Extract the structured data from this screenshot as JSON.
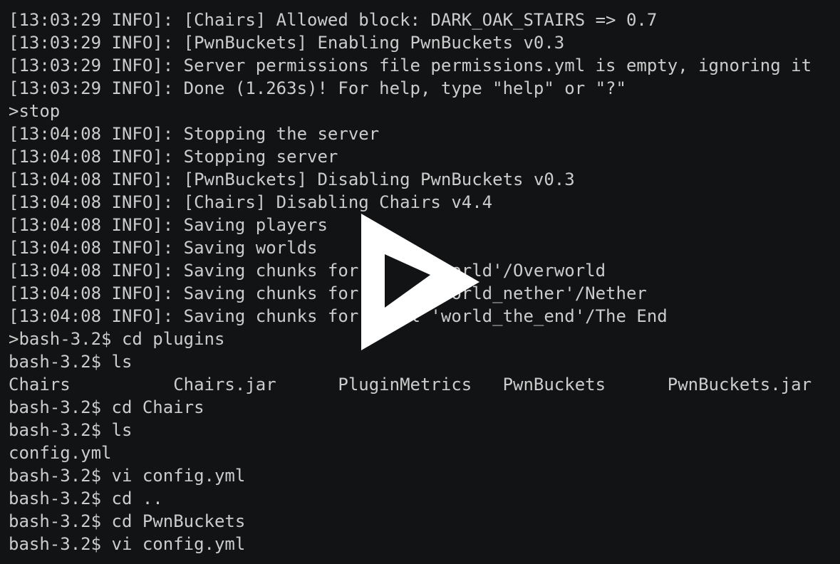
{
  "terminal": {
    "lines": [
      "[13:03:29 INFO]: [Chairs] Allowed block: DARK_OAK_STAIRS => 0.7",
      "[13:03:29 INFO]: [PwnBuckets] Enabling PwnBuckets v0.3",
      "[13:03:29 INFO]: Server permissions file permissions.yml is empty, ignoring it",
      "[13:03:29 INFO]: Done (1.263s)! For help, type \"help\" or \"?\"",
      ">stop",
      "[13:04:08 INFO]: Stopping the server",
      "[13:04:08 INFO]: Stopping server",
      "[13:04:08 INFO]: [PwnBuckets] Disabling PwnBuckets v0.3",
      "[13:04:08 INFO]: [Chairs] Disabling Chairs v4.4",
      "[13:04:08 INFO]: Saving players",
      "[13:04:08 INFO]: Saving worlds",
      "[13:04:08 INFO]: Saving chunks for level 'world'/Overworld",
      "[13:04:08 INFO]: Saving chunks for level 'world_nether'/Nether",
      "[13:04:08 INFO]: Saving chunks for level 'world_the_end'/The End",
      ">bash-3.2$ cd plugins",
      "bash-3.2$ ls",
      "Chairs          Chairs.jar      PluginMetrics   PwnBuckets      PwnBuckets.jar",
      "bash-3.2$ cd Chairs",
      "bash-3.2$ ls",
      "config.yml",
      "bash-3.2$ vi config.yml",
      "bash-3.2$ cd ..",
      "bash-3.2$ cd PwnBuckets",
      "bash-3.2$ vi config.yml"
    ]
  },
  "overlay": {
    "icon": "asciinema-play-icon",
    "color": "#ffffff"
  },
  "colors": {
    "background": "#121314",
    "text": "#cccccc"
  }
}
